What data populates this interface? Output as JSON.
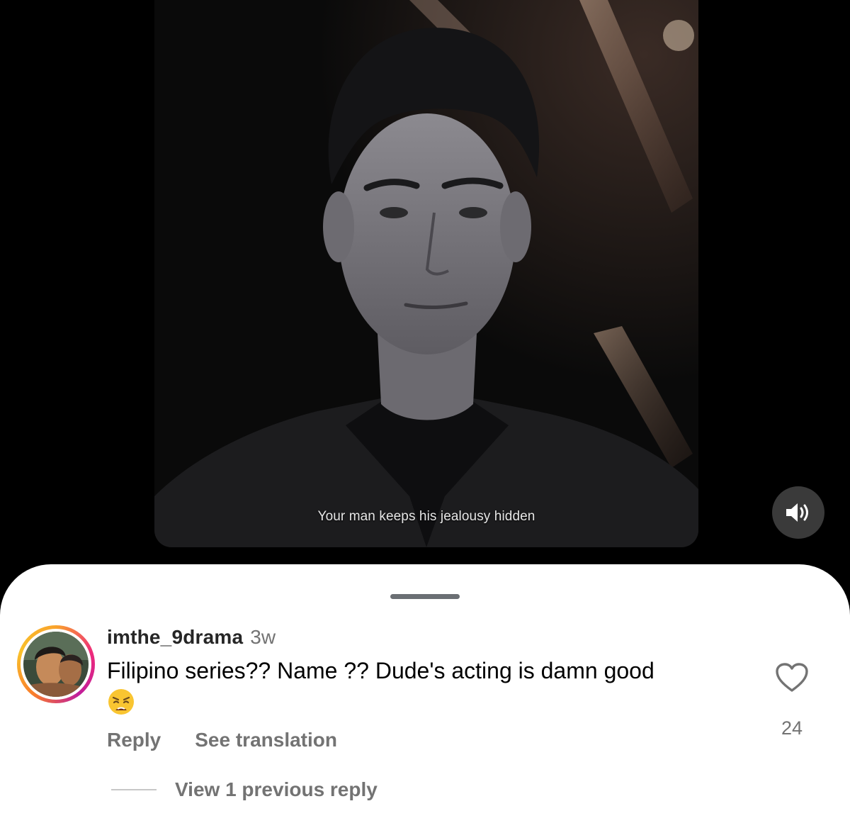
{
  "video": {
    "subtitle": "Your man keeps his jealousy hidden",
    "mute_icon": "speaker-icon"
  },
  "comment": {
    "username": "imthe_9drama",
    "timestamp": "3w",
    "text": "Filipino series?? Name ?? Dude's acting is damn good",
    "emoji": "😩",
    "reply_label": "Reply",
    "translate_label": "See translation",
    "like_count": "24",
    "view_replies_label": "View 1 previous reply"
  },
  "colors": {
    "secondary_text": "#737373",
    "primary_text": "#000000",
    "story_ring": [
      "#f9a32b",
      "#ee2a7b",
      "#c01e9b"
    ]
  }
}
